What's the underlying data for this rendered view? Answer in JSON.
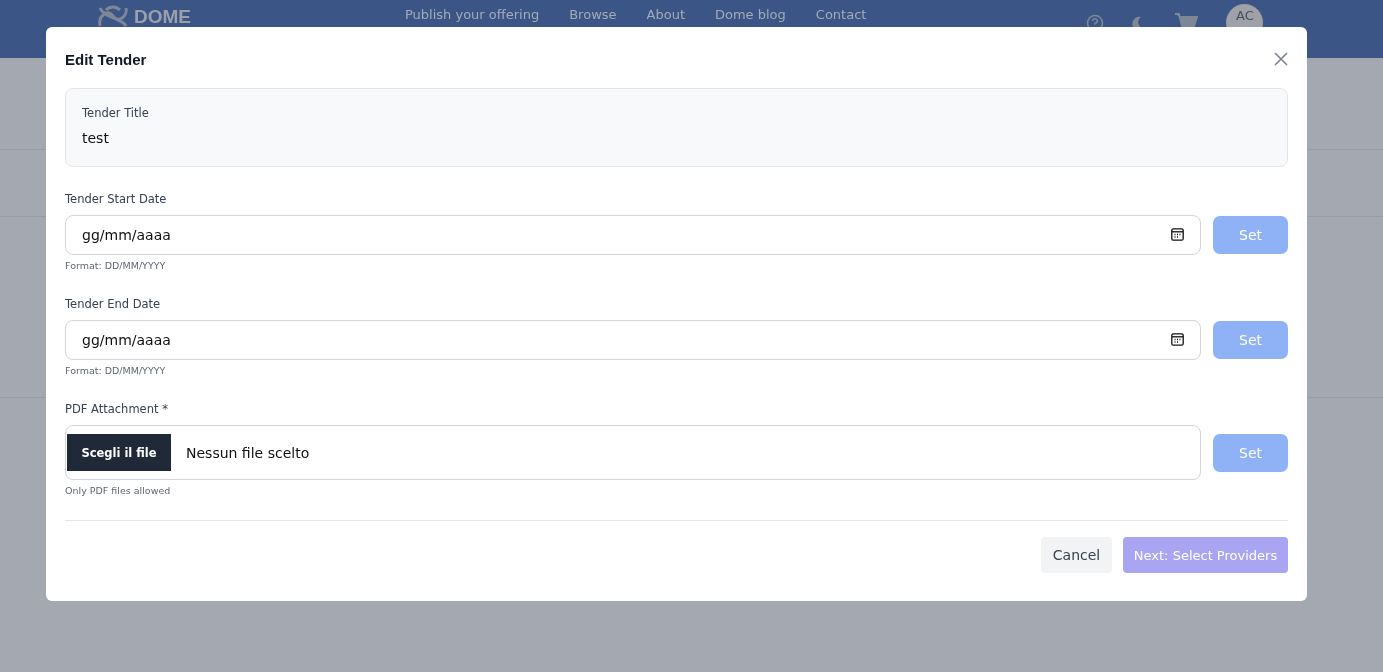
{
  "header": {
    "logo": "DOME",
    "nav": [
      "Publish your offering",
      "Browse",
      "About",
      "Dome blog",
      "Contact"
    ],
    "avatar": "AC"
  },
  "dialog": {
    "title": "Edit Tender",
    "title_field": {
      "label": "Tender Title",
      "value": "test"
    },
    "date_fields": [
      {
        "label": "Tender Start Date",
        "placeholder": "gg/mm/aaaa",
        "hint": "Format: DD/MM/YYYY",
        "button": "Set"
      },
      {
        "label": "Tender End Date",
        "placeholder": "gg/mm/aaaa",
        "hint": "Format: DD/MM/YYYY",
        "button": "Set"
      }
    ],
    "file_field": {
      "label": "PDF Attachment *",
      "choose": "Scegli il file",
      "status": "Nessun file scelto",
      "hint": "Only PDF files allowed",
      "button": "Set"
    },
    "buttons": {
      "cancel": "Cancel",
      "next": "Next: Select Providers"
    }
  }
}
